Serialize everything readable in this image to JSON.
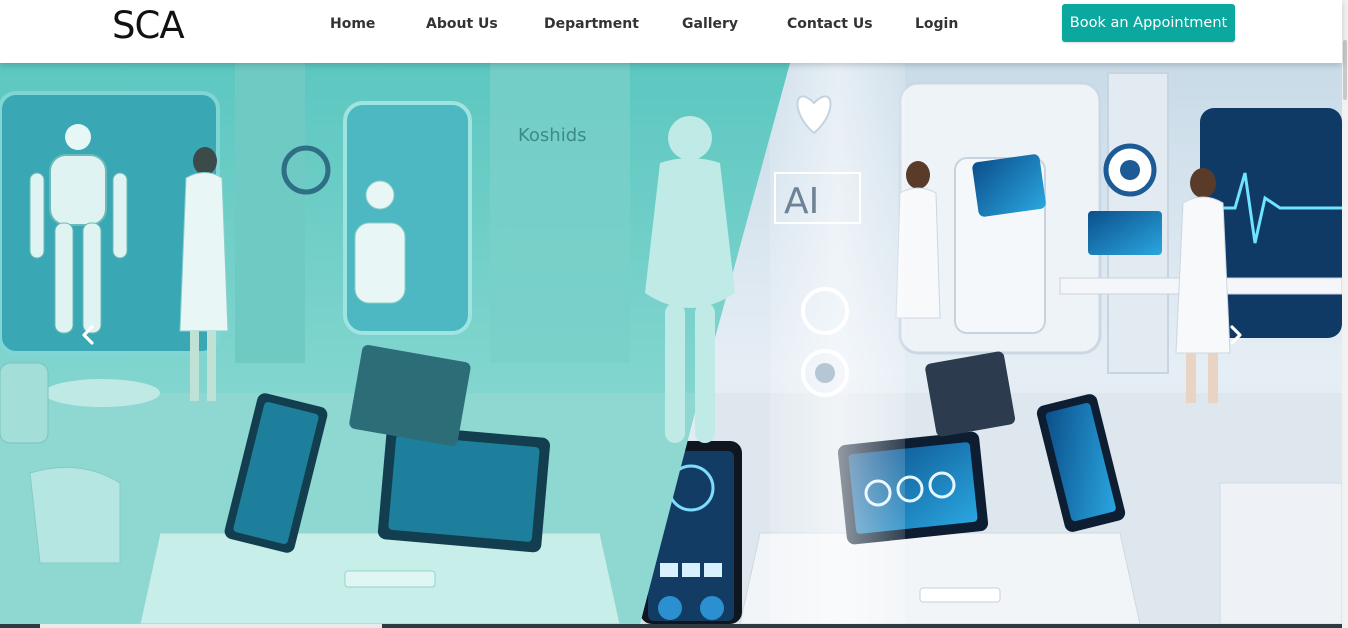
{
  "brand": {
    "name": "SCA"
  },
  "nav": {
    "items": [
      {
        "label": "Home"
      },
      {
        "label": "About Us"
      },
      {
        "label": "Department"
      },
      {
        "label": "Gallery"
      },
      {
        "label": "Contact Us"
      },
      {
        "label": "Login"
      }
    ],
    "cta_label": "Book an Appointment"
  },
  "hero": {
    "slide_text": {
      "ai": "AI",
      "sign": "Koshids"
    },
    "icons": {
      "prev": "chevron-left-icon",
      "next": "chevron-right-icon"
    }
  },
  "colors": {
    "accent": "#0aa89e",
    "teal_overlay": "#40c4b8",
    "nav_text": "#333333"
  }
}
